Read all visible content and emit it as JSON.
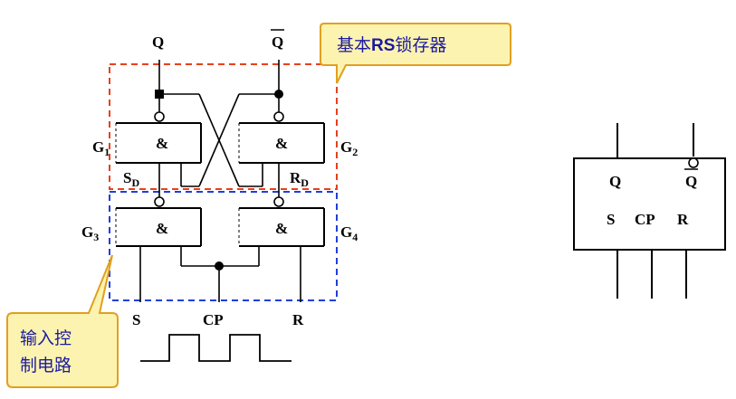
{
  "labels": {
    "q": "Q",
    "qbar": "Q",
    "g1": "G",
    "g1_sub": "1",
    "g2": "G",
    "g2_sub": "2",
    "g3": "G",
    "g3_sub": "3",
    "g4": "G",
    "g4_sub": "4",
    "gate_symbol": "&",
    "sd": "S",
    "sd_sub": "D",
    "rd": "R",
    "rd_sub": "D",
    "s": "S",
    "cp": "CP",
    "r": "R"
  },
  "callouts": {
    "top_pre": "基本",
    "top_bold": "RS",
    "top_post": "锁存器",
    "bottom_line1": "输入控",
    "bottom_line2": "制电路"
  },
  "symbol": {
    "q": "Q",
    "qbar": "Q",
    "s": "S",
    "cp": "CP",
    "r": "R"
  },
  "colors": {
    "latch_box": "#e8401c",
    "input_box": "#1f3fd8",
    "callout_fill": "#fdf3b0",
    "callout_border": "#e0a020",
    "callout_text": "#1a1aa0"
  }
}
